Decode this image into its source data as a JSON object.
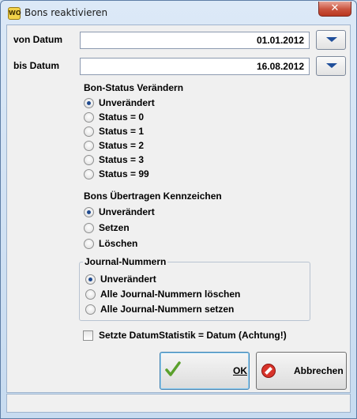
{
  "window": {
    "title": "Bons reaktivieren",
    "app_icon_text": "WO",
    "close_glyph": "✕"
  },
  "dates": {
    "from_label": "von Datum",
    "from_value": "01.01.2012",
    "to_label": "bis Datum",
    "to_value": "16.08.2012"
  },
  "bon_status": {
    "title": "Bon-Status Verändern",
    "selected": "Unverändert",
    "options": [
      "Unverändert",
      "Status = 0",
      "Status = 1",
      "Status = 2",
      "Status = 3",
      "Status = 99"
    ]
  },
  "transfer_flag": {
    "title": "Bons Übertragen Kennzeichen",
    "selected": "Unverändert",
    "options": [
      "Unverändert",
      "Setzen",
      "Löschen"
    ]
  },
  "journal": {
    "title": "Journal-Nummern",
    "selected": "Unverändert",
    "options": [
      "Unverändert",
      "Alle Journal-Nummern löschen",
      "Alle Journal-Nummern setzen"
    ]
  },
  "statistic_checkbox": {
    "label": "Setzte DatumStatistik = Datum (Achtung!)",
    "checked": false
  },
  "buttons": {
    "ok_label": "OK",
    "cancel_label": "Abbrechen"
  },
  "colors": {
    "accent_radio": "#1f4a8f",
    "ok_check": "#5aa02c",
    "cancel_icon": "#d8332a"
  }
}
